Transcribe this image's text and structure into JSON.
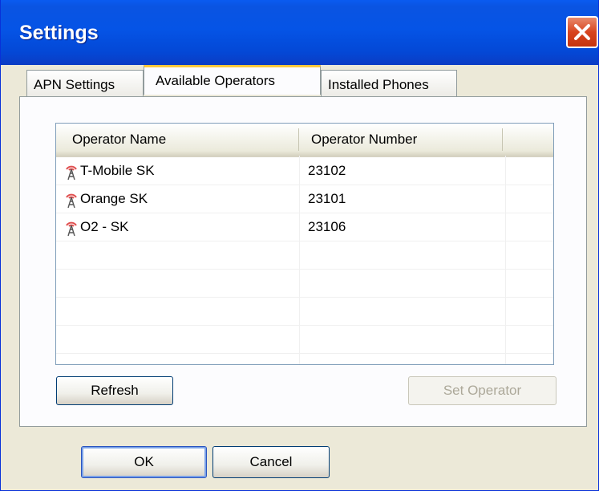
{
  "window": {
    "title": "Settings",
    "close_icon": "close-icon"
  },
  "tabs": [
    {
      "label": "APN Settings",
      "active": false
    },
    {
      "label": "Available Operators",
      "active": true
    },
    {
      "label": "Installed Phones",
      "active": false
    }
  ],
  "operators_table": {
    "columns": [
      "Operator Name",
      "Operator Number"
    ],
    "rows": [
      {
        "name": "T-Mobile SK",
        "number": "23102",
        "icon": "antenna-icon"
      },
      {
        "name": "Orange SK",
        "number": "23101",
        "icon": "antenna-icon"
      },
      {
        "name": "O2 - SK",
        "number": "23106",
        "icon": "antenna-icon"
      }
    ]
  },
  "buttons": {
    "refresh": "Refresh",
    "set_operator": "Set Operator",
    "ok": "OK",
    "cancel": "Cancel"
  },
  "colors": {
    "titlebar": "#0a54e2",
    "close": "#d8441f",
    "active_tab_accent": "#ffc83c"
  }
}
